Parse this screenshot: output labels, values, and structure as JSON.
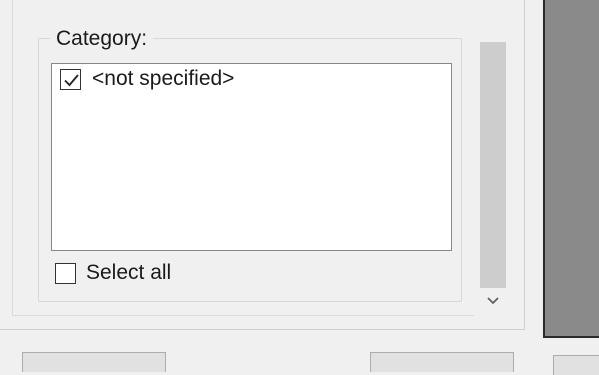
{
  "category_group": {
    "legend": "Category:",
    "items": [
      {
        "label": "<not specified>",
        "checked": true
      }
    ]
  },
  "select_all": {
    "label": "Select all",
    "checked": false
  },
  "icons": {
    "check": "checkmark-icon",
    "scroll_down": "chevron-down-icon"
  },
  "colors": {
    "panel_bg": "#f0f0f0",
    "list_bg": "#ffffff",
    "scroll_thumb": "#cdcdcd",
    "preview_bg": "#8a8a8a"
  }
}
